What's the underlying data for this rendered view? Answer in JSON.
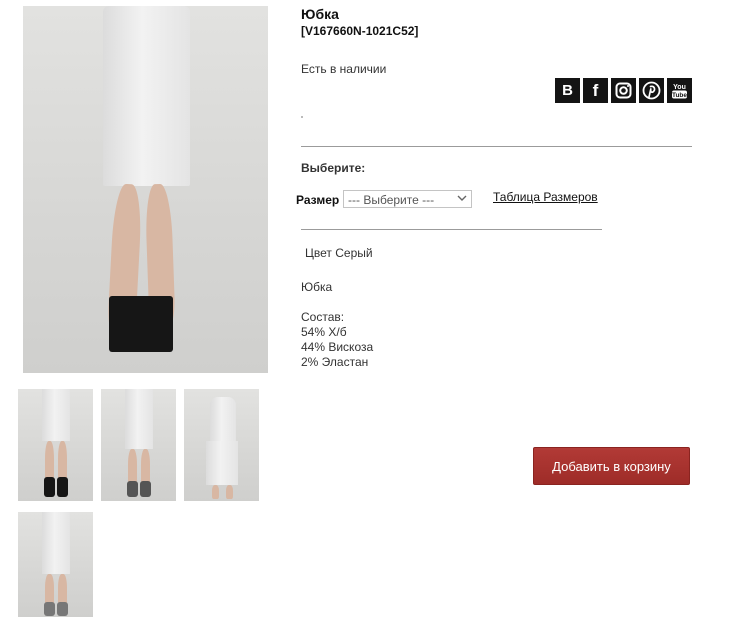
{
  "product": {
    "title": "Юбка",
    "sku": "[V167660N-1021C52]",
    "availability": "Есть в наличии",
    "choose_label": "Выберите:",
    "size_label": "Размер",
    "size_select_value": "--- Выберите ---",
    "size_table_link": "Таблица Размеров",
    "color_line": "Цвет Серый",
    "description": {
      "name": "Юбка",
      "composition_label": "Состав:",
      "composition": [
        "54% Х/б",
        "44% Вискоза",
        "2% Эластан"
      ]
    },
    "add_to_cart_label": "Добавить в корзину"
  },
  "social": [
    {
      "name": "vk-icon",
      "glyph": "В"
    },
    {
      "name": "facebook-icon",
      "glyph": "f"
    },
    {
      "name": "instagram-icon",
      "glyph": ""
    },
    {
      "name": "pinterest-icon",
      "glyph": ""
    },
    {
      "name": "youtube-icon",
      "glyph": ""
    }
  ],
  "colors": {
    "cart_button": "#a8322e",
    "social_bg": "#141414",
    "divider": "#9b9b9b"
  }
}
